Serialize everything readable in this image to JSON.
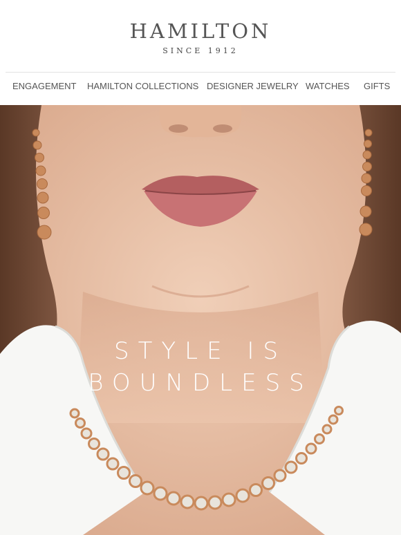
{
  "brand": {
    "name": "HAMILTON",
    "tagline": "SINCE 1912"
  },
  "nav": {
    "items": [
      {
        "label": "ENGAGEMENT"
      },
      {
        "label": "HAMILTON COLLECTIONS"
      },
      {
        "label": "DESIGNER JEWELRY"
      },
      {
        "label": "WATCHES"
      },
      {
        "label": "GIFTS"
      }
    ]
  },
  "hero": {
    "headline_line1": "STYLE IS",
    "headline_line2": "BOUNDLESS",
    "colors": {
      "skin": "#e9c3aa",
      "hair": "#6b4530",
      "shirt": "#f7f7f5",
      "lips": "#c26a6a",
      "gold": "#c98a5c"
    }
  }
}
